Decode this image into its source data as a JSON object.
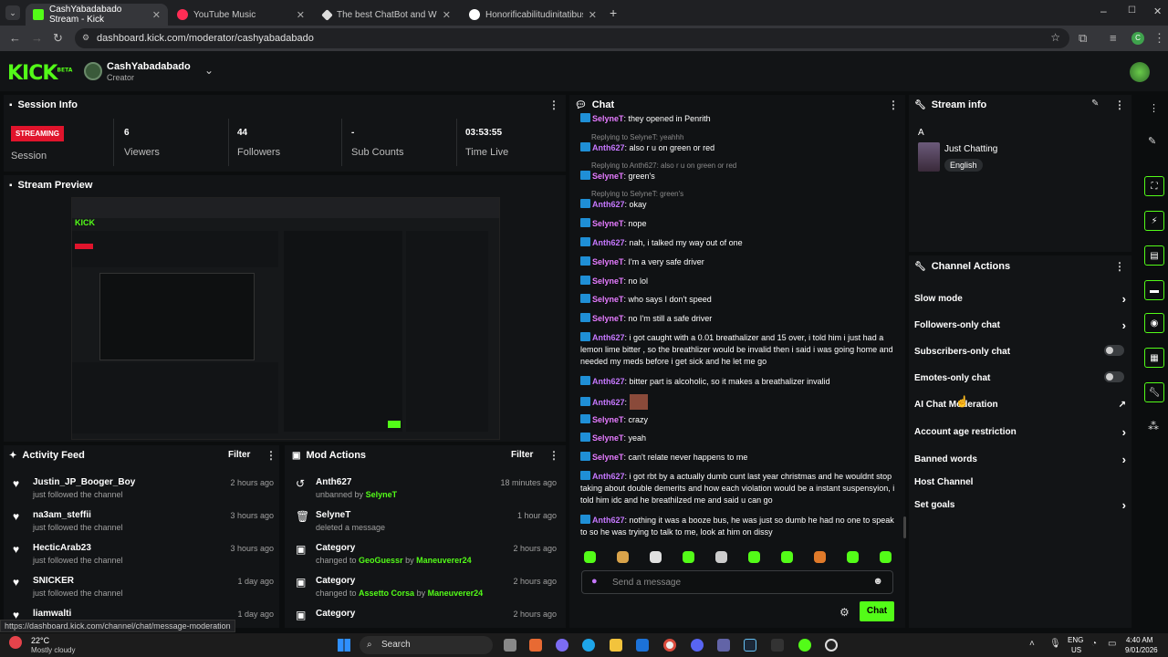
{
  "browser": {
    "tabs": [
      {
        "label": "CashYabadabado Stream - Kick",
        "active": true
      },
      {
        "label": "YouTube Music"
      },
      {
        "label": "The best ChatBot and Widgets"
      },
      {
        "label": "Honorificabilitudinitatibus - Go"
      }
    ],
    "url": "dashboard.kick.com/moderator/cashyabadabado"
  },
  "header": {
    "logo": "KICK",
    "beta": "BETA",
    "channel": "CashYabadabado",
    "role": "Creator"
  },
  "session": {
    "title": "Session Info",
    "streaming": "STREAMING",
    "session_label": "Session",
    "viewers": "6",
    "viewers_label": "Viewers",
    "followers": "44",
    "followers_label": "Followers",
    "subs": "-",
    "subs_label": "Sub Counts",
    "time": "03:53:55",
    "time_label": "Time Live"
  },
  "preview": {
    "title": "Stream Preview"
  },
  "activity": {
    "title": "Activity Feed",
    "filter": "Filter",
    "items": [
      {
        "name": "Justin_JP_Booger_Boy",
        "sub": "just followed the channel",
        "time": "2 hours ago"
      },
      {
        "name": "na3am_steffii",
        "sub": "just followed the channel",
        "time": "3 hours ago"
      },
      {
        "name": "HecticArab23",
        "sub": "just followed the channel",
        "time": "3 hours ago"
      },
      {
        "name": "SNICKER",
        "sub": "just followed the channel",
        "time": "1 day ago"
      },
      {
        "name": "liamwalti",
        "sub": "",
        "time": "1 day ago"
      }
    ]
  },
  "mod": {
    "title": "Mod Actions",
    "filter": "Filter",
    "items": [
      {
        "name": "Anth627",
        "sub_pre": "unbanned by ",
        "sub_user": "SelyneT",
        "sub_mid": "",
        "sub_user2": "",
        "time": "18 minutes ago"
      },
      {
        "name": "SelyneT",
        "sub_pre": "deleted a message",
        "sub_user": "",
        "sub_mid": "",
        "sub_user2": "",
        "time": "1 hour ago"
      },
      {
        "name": "Category",
        "sub_pre": "changed to ",
        "sub_user": "GeoGuessr",
        "sub_mid": " by ",
        "sub_user2": "Maneuverer24",
        "time": "2 hours ago"
      },
      {
        "name": "Category",
        "sub_pre": "changed to ",
        "sub_user": "Assetto Corsa",
        "sub_mid": " by ",
        "sub_user2": "Maneuverer24",
        "time": "2 hours ago"
      },
      {
        "name": "Category",
        "sub_pre": "",
        "sub_user": "",
        "sub_mid": "",
        "sub_user2": "",
        "time": "2 hours ago"
      }
    ]
  },
  "chat": {
    "title": "Chat",
    "placeholder": "Send a message",
    "send": "Chat",
    "messages": [
      {
        "reply": "",
        "user": "SelyneT",
        "text": "they opened in Penrith"
      },
      {
        "reply": "Replying to SelyneT: yeahhh",
        "user": "Anth627",
        "text": "also r u on green or red"
      },
      {
        "reply": "Replying to Anth627: also r u on green or red",
        "user": "SelyneT",
        "text": "green's"
      },
      {
        "reply": "Replying to SelyneT: green's",
        "user": "Anth627",
        "text": "okay"
      },
      {
        "reply": "",
        "user": "SelyneT",
        "text": "nope"
      },
      {
        "reply": "",
        "user": "Anth627",
        "text": "nah, i talked my way out of one"
      },
      {
        "reply": "",
        "user": "SelyneT",
        "text": "I'm a very safe driver"
      },
      {
        "reply": "",
        "user": "SelyneT",
        "text": "no lol"
      },
      {
        "reply": "",
        "user": "SelyneT",
        "text": "who says I don't speed"
      },
      {
        "reply": "",
        "user": "SelyneT",
        "text": "no I'm still a safe driver"
      },
      {
        "reply": "",
        "user": "Anth627",
        "text": "i got caught with a 0.01 breathalizer and 15 over, i told him i just had a lemon lime bitter , so the breathlizer would be invalid then i said i was going home and needed my meds before i get sick and he let me go"
      },
      {
        "reply": "",
        "user": "Anth627",
        "text": "bitter part is alcoholic, so it makes a breathalizer invalid"
      },
      {
        "reply": "",
        "user": "Anth627",
        "text": ""
      },
      {
        "reply": "",
        "user": "SelyneT",
        "text": "crazy"
      },
      {
        "reply": "",
        "user": "SelyneT",
        "text": "yeah"
      },
      {
        "reply": "",
        "user": "SelyneT",
        "text": "can't relate never happens to me"
      },
      {
        "reply": "",
        "user": "Anth627",
        "text": "i got rbt by a actually dumb cunt last year christmas and he wouldnt stop taking about double demerits and how each violation would be a instant suspensyion, i told him idc and he breathilzed me and said u can go"
      },
      {
        "reply": "",
        "user": "Anth627",
        "text": "nothing it was a booze bus, he was just so dumb he had no one to speak to so he was trying to talk to me, look at him on dissy"
      }
    ]
  },
  "stream_info": {
    "title": "Stream info",
    "letter": "A",
    "category": "Just Chatting",
    "language": "English"
  },
  "channel_actions": {
    "title": "Channel Actions",
    "items": [
      {
        "label": "Slow mode",
        "control": "chevron"
      },
      {
        "label": "Followers-only chat",
        "control": "chevron"
      },
      {
        "label": "Subscribers-only chat",
        "control": "toggle"
      },
      {
        "label": "Emotes-only chat",
        "control": "toggle"
      },
      {
        "label": "AI Chat Moderation",
        "control": "external"
      },
      {
        "label": "Account age restriction",
        "control": "chevron"
      },
      {
        "label": "Banned words",
        "control": "chevron"
      },
      {
        "label": "Host Channel",
        "control": "none"
      },
      {
        "label": "Set goals",
        "control": "chevron"
      }
    ]
  },
  "status_url": "https://dashboard.kick.com/channel/chat/message-moderation",
  "taskbar": {
    "temp": "22°C",
    "weather": "Mostly cloudy",
    "search": "Search",
    "lang1": "ENG",
    "lang2": "US",
    "time": "4:40 AM",
    "date": "9/01/2026"
  },
  "colors": {
    "accent": "#53fc18",
    "streaming": "#e0142c",
    "username": "#c678ff"
  }
}
